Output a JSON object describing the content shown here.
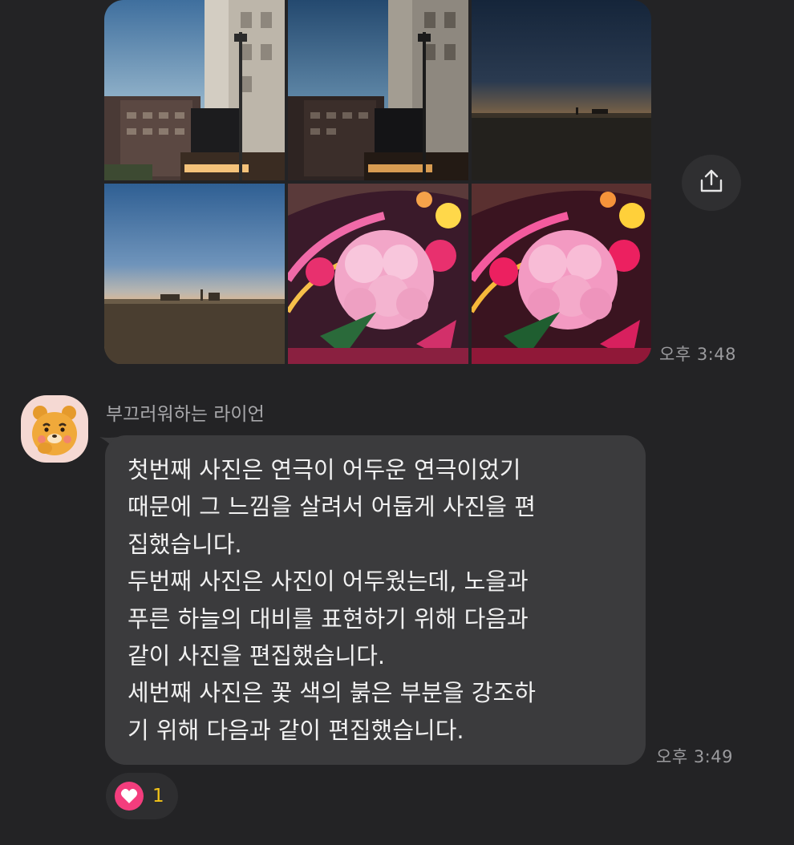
{
  "photos": [
    {
      "name": "building-dusk-photo-1",
      "kind": "building"
    },
    {
      "name": "building-dusk-photo-2",
      "kind": "building"
    },
    {
      "name": "dark-field-sunset-photo",
      "kind": "dark-field"
    },
    {
      "name": "sunset-sky-field-photo",
      "kind": "sky-field"
    },
    {
      "name": "pink-flower-bouquet-photo-1",
      "kind": "flowers"
    },
    {
      "name": "pink-flower-bouquet-photo-2",
      "kind": "flowers"
    }
  ],
  "share_icon": "share-upload-icon",
  "first_group_time": "오후 3:48",
  "message": {
    "sender": "부끄러워하는 라이언",
    "lines": [
      "첫번째 사진은 연극이 어두운 연극이었기",
      "때문에 그 느낌을 살려서 어둡게 사진을 편",
      "집했습니다.",
      "두번째 사진은 사진이 어두웠는데, 노을과",
      "푸른 하늘의 대비를 표현하기 위해 다음과",
      "같이 사진을 편집했습니다.",
      "세번째 사진은 꽃 색의 붉은 부분을 강조하",
      "기 위해 다음과 같이 편집했습니다."
    ],
    "time": "오후 3:49"
  },
  "reaction": {
    "icon": "heart-icon",
    "count": "1"
  },
  "colors": {
    "background": "#232325",
    "bubble": "#3b3b3d",
    "heart": "#f43d7d",
    "count": "#f5c518"
  }
}
